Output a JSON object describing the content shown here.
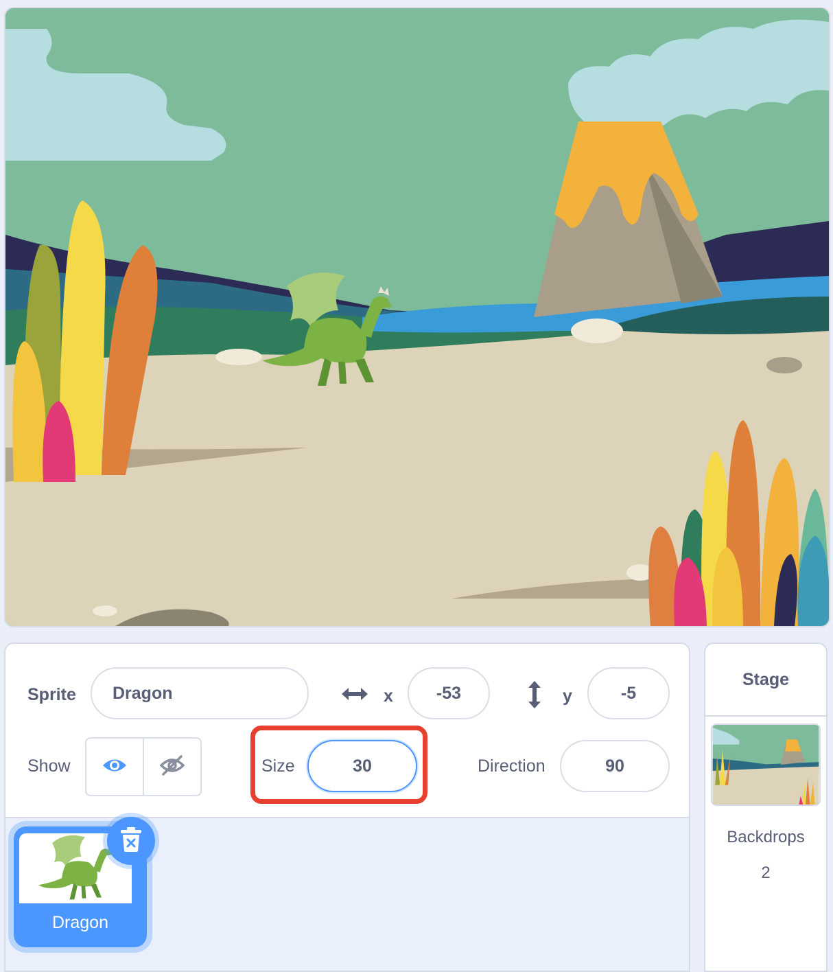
{
  "sprite_info": {
    "sprite_label": "Sprite",
    "sprite_name": "Dragon",
    "x_label": "x",
    "x_value": "-53",
    "y_label": "y",
    "y_value": "-5",
    "show_label": "Show",
    "show_visible": true,
    "size_label": "Size",
    "size_value": "30",
    "direction_label": "Direction",
    "direction_value": "90"
  },
  "sprites": [
    {
      "name": "Dragon",
      "selected": true
    }
  ],
  "stage_panel": {
    "title": "Stage",
    "backdrops_label": "Backdrops",
    "backdrops_count": "2"
  },
  "colors": {
    "accent": "#4c97ff",
    "highlight": "#e8402f",
    "text": "#575e75",
    "border": "#d5dae6"
  },
  "icons": [
    "move-horizontal-icon",
    "move-vertical-icon",
    "eye-icon",
    "eye-off-icon",
    "trash-icon"
  ]
}
